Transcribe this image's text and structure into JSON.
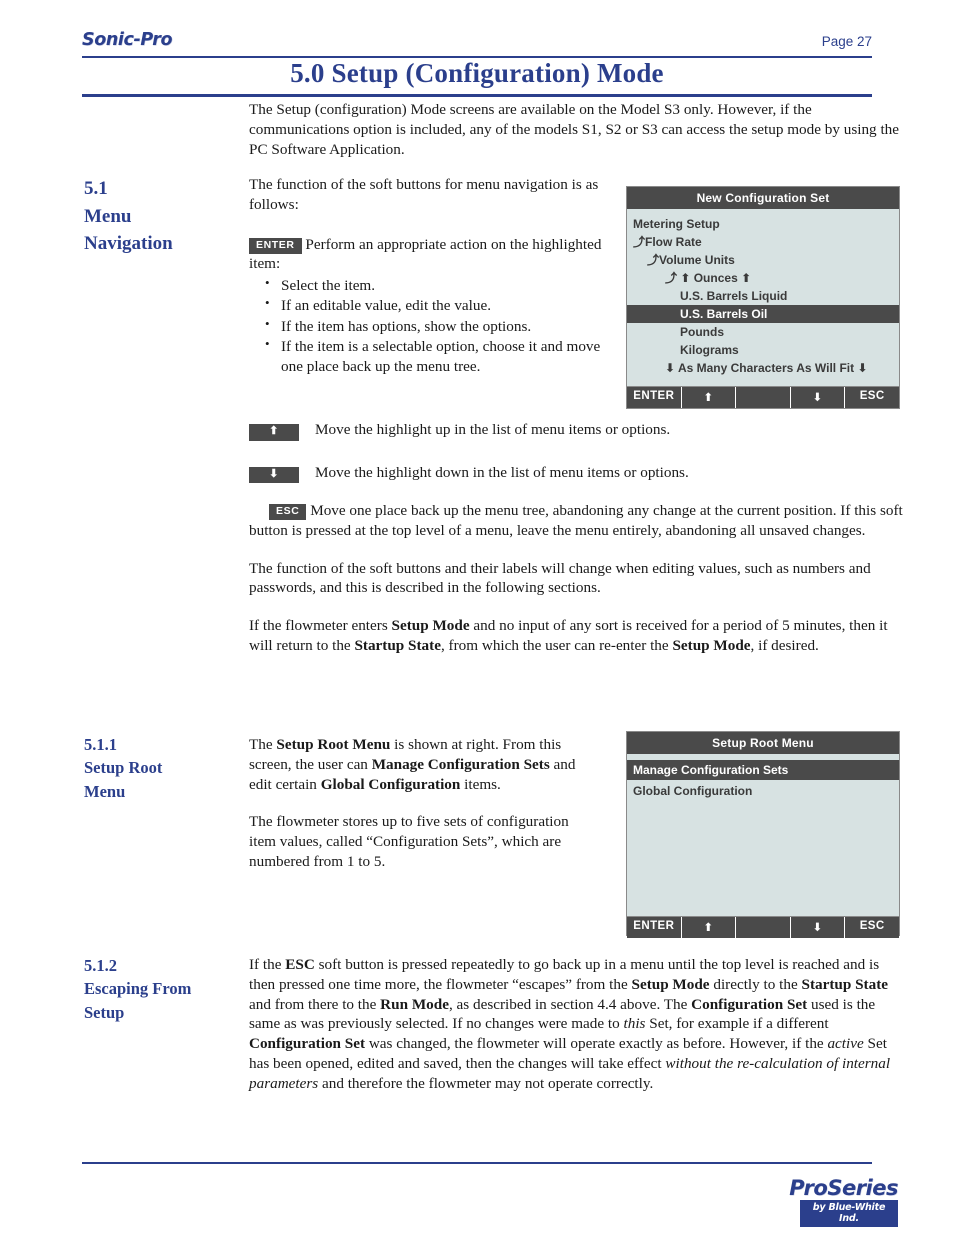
{
  "header": {
    "brand": "Sonic-Pro",
    "page_label": "Page 27",
    "chapter_title": "5.0 Setup (Configuration) Mode",
    "accent_color": "#2b3f8c"
  },
  "intro": {
    "text": "The Setup (configuration) Mode screens are available on the Model S3 only. However, if the communications option is included, any of the models S1, S2 or S3 can access the setup mode by using the PC Software Application."
  },
  "section_51": {
    "number": "5.1",
    "title_line1": "Menu",
    "title_line2": "Navigation",
    "lead": "The function of the soft buttons for menu navigation is as follows:",
    "enter_key": "ENTER",
    "enter_text": "Perform an appropriate action on the highlighted item:",
    "bullets": [
      "Select the item.",
      "If an editable value, edit the value.",
      "If the item has options, show the options.",
      "If the item is a selectable option, choose it and move one place back up the menu tree."
    ],
    "up_key": "⬆",
    "up_text": "Move the highlight up in the list of menu items or options.",
    "down_key": "⬇",
    "down_text": "Move the highlight down in the list of menu items or options.",
    "esc_key": "ESC",
    "esc_text": "Move one place back up the menu tree, abandoning any change at the current position. If this soft button is pressed at the top level of a menu, leave the menu entirely, abandoning all unsaved changes.",
    "para_softbuttons": "The function of the soft buttons and their labels will change when editing values, such as numbers and passwords, and this is described in the following sections.",
    "para_timeout_1": "If the flowmeter enters ",
    "para_timeout_b1": "Setup Mode",
    "para_timeout_2": " and no input of any sort is received for a period of 5 minutes, then it will return to the ",
    "para_timeout_b2": "Startup State",
    "para_timeout_3": ", from which the user can re-enter the ",
    "para_timeout_b3": "Setup Mode",
    "para_timeout_4": ", if desired."
  },
  "lcd_new_config": {
    "title": "New Configuration Set",
    "lines": [
      {
        "text": "Metering Setup",
        "indent": 1,
        "highlight": false
      },
      {
        "text": "⤴Flow Rate",
        "indent": 1,
        "highlight": false
      },
      {
        "text": "⤴Volume Units",
        "indent": 2,
        "highlight": false
      },
      {
        "text": "⤴ ⬆ Ounces ⬆",
        "indent": 3,
        "highlight": false
      },
      {
        "text": "U.S. Barrels Liquid",
        "indent": 4,
        "highlight": false
      },
      {
        "text": "U.S. Barrels Oil",
        "indent": 4,
        "highlight": true
      },
      {
        "text": "Pounds",
        "indent": 4,
        "highlight": false
      },
      {
        "text": "Kilograms",
        "indent": 4,
        "highlight": false
      },
      {
        "text": "⬇ As Many Characters As Will Fit ⬇",
        "indent": 3,
        "highlight": false
      }
    ],
    "softkeys": [
      "ENTER",
      "⬆",
      "",
      "⬇",
      "ESC"
    ]
  },
  "section_511": {
    "number": "5.1.1",
    "title_line1": "Setup Root",
    "title_line2": "Menu",
    "para1_a": "The ",
    "para1_b1": "Setup Root Menu",
    "para1_c": " is shown at right. From this screen, the user can ",
    "para1_b2": "Manage Configuration Sets",
    "para1_d": " and edit certain ",
    "para1_b3": "Global Configuration",
    "para1_e": " items.",
    "para2": "The flowmeter stores up to five sets of configuration item values, called “Configuration Sets”, which are numbered from 1 to 5."
  },
  "lcd_setup_root": {
    "title": "Setup Root Menu",
    "lines": [
      {
        "text": "Manage Configuration Sets",
        "indent": 1,
        "highlight": true
      },
      {
        "text": "Global Configuration",
        "indent": 1,
        "highlight": false
      }
    ],
    "softkeys": [
      "ENTER",
      "⬆",
      "",
      "⬇",
      "ESC"
    ]
  },
  "section_512": {
    "number": "5.1.2",
    "title_line1": "Escaping From",
    "title_line2": "Setup",
    "p_a1": "If the ",
    "p_b1": "ESC",
    "p_a2": " soft button is pressed repeatedly to go back up in a menu until the top level is reached and is then pressed one time more, the flowmeter “escapes” from the ",
    "p_b2": "Setup Mode",
    "p_a3": " directly to the ",
    "p_b3": "Startup State",
    "p_a4": " and from there to the ",
    "p_b4": "Run Mode",
    "p_a5": ", as described in section 4.4 above. The ",
    "p_b5": "Configuration Set",
    "p_a6": " used is the same as was previously selected. If no changes were made to ",
    "p_i1": "this",
    "p_a7": " Set, for example if a different ",
    "p_b6": "Configuration Set",
    "p_a8": " was changed, the flowmeter will operate exactly as before. However, if the ",
    "p_i2": "active",
    "p_a9": " Set has been opened, edited and saved, then the changes will take effect ",
    "p_i3": "without the re-calculation of internal parameters",
    "p_a10": " and therefore the flowmeter may not operate correctly."
  },
  "footer": {
    "logo_word": "ProSeries",
    "logo_tagline": "by Blue-White Ind."
  }
}
